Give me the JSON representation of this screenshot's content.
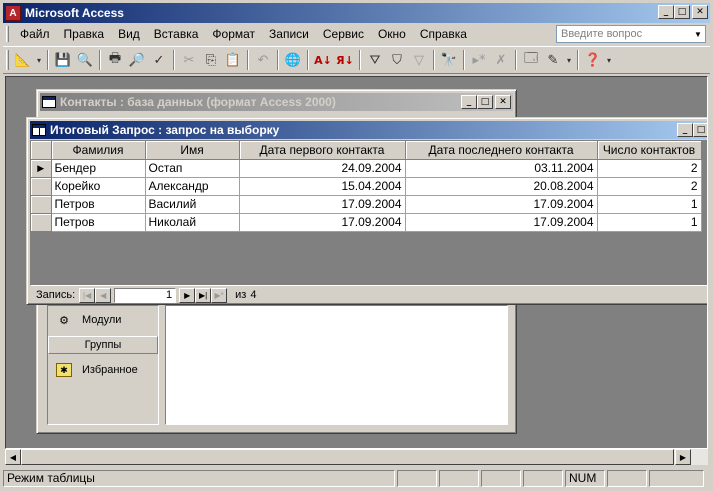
{
  "app": {
    "title": "Microsoft Access",
    "icon_label": "A"
  },
  "menu": {
    "items": [
      "Файл",
      "Правка",
      "Вид",
      "Вставка",
      "Формат",
      "Записи",
      "Сервис",
      "Окно",
      "Справка"
    ],
    "help_placeholder": "Введите вопрос"
  },
  "toolbar": {
    "icons": [
      "view-design-icon",
      "save-icon",
      "search-file-icon",
      "print-icon",
      "print-preview-icon",
      "spelling-icon",
      "cut-icon",
      "copy-icon",
      "paste-icon",
      "undo-icon",
      "hyperlink-icon",
      "sort-ascending-icon",
      "sort-descending-icon",
      "filter-by-selection-icon",
      "filter-by-form-icon",
      "apply-filter-icon",
      "find-icon",
      "new-record-icon",
      "delete-record-icon",
      "database-window-icon",
      "new-object-icon",
      "help-icon"
    ]
  },
  "db_window": {
    "title": "Контакты : база данных (формат Access 2000)",
    "modules_label": "Модули",
    "groups_label": "Группы",
    "favorites_label": "Избранное"
  },
  "query_window": {
    "title": "Итоговый Запрос : запрос на выборку",
    "columns": [
      "Фамилия",
      "Имя",
      "Дата первого контакта",
      "Дата последнего контакта",
      "Число контактов"
    ],
    "rows": [
      {
        "last_name": "Бендер",
        "first_name": "Остап",
        "first_contact": "24.09.2004",
        "last_contact": "03.11.2004",
        "count": "2"
      },
      {
        "last_name": "Корейко",
        "first_name": "Александр",
        "first_contact": "15.04.2004",
        "last_contact": "20.08.2004",
        "count": "2"
      },
      {
        "last_name": "Петров",
        "first_name": "Василий",
        "first_contact": "17.09.2004",
        "last_contact": "17.09.2004",
        "count": "1"
      },
      {
        "last_name": "Петров",
        "first_name": "Николай",
        "first_contact": "17.09.2004",
        "last_contact": "17.09.2004",
        "count": "1"
      }
    ],
    "nav": {
      "record_label": "Запись:",
      "current": "1",
      "of_label": "из",
      "total": "4"
    }
  },
  "status": {
    "mode": "Режим таблицы",
    "num": "NUM"
  },
  "colors": {
    "active_title_start": "#0a246a",
    "active_title_end": "#a6caf0",
    "inactive_title_start": "#808080",
    "face": "#d4d0c8",
    "mdi_bg": "#808080"
  }
}
